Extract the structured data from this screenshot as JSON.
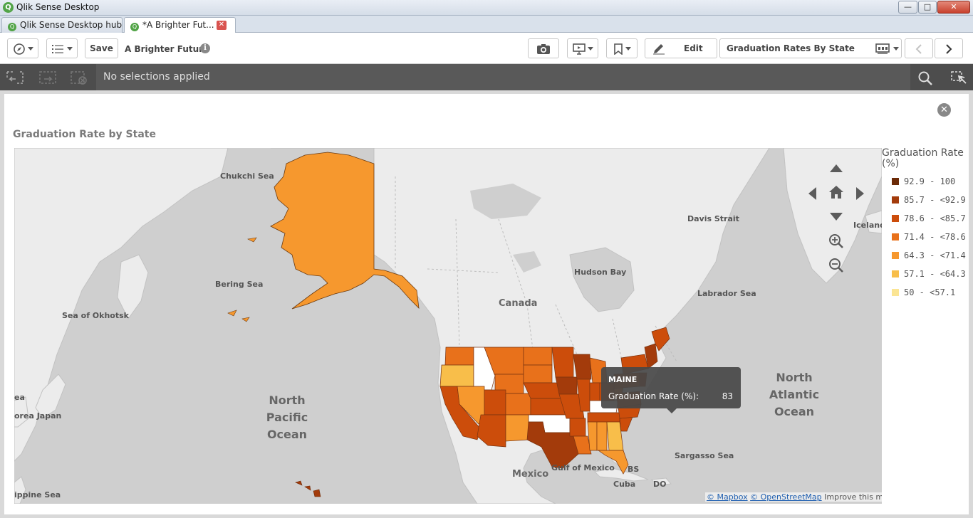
{
  "window": {
    "title": "Qlik Sense Desktop",
    "min_glyph": "—",
    "max_glyph": "□",
    "close_glyph": "✕"
  },
  "tabs": [
    {
      "label": "Qlik Sense Desktop hub"
    },
    {
      "label": "*A Brighter Fut..."
    }
  ],
  "toolbar": {
    "save_label": "Save",
    "app_name": "A Brighter Future",
    "info_glyph": "i",
    "edit_label": "Edit",
    "sheet_name": "Graduation Rates By State"
  },
  "selections": {
    "status_text": "No selections applied"
  },
  "chart": {
    "title": "Graduation Rate by State",
    "close_glyph": "✕"
  },
  "map_labels": {
    "chukchi_sea": "Chukchi Sea",
    "bering_sea": "Bering Sea",
    "sea_of_okhotsk": "Sea of Okhotsk",
    "north_pacific_ocean": "North\nPacific\nOcean",
    "north_atlantic_ocean": "North\nAtlantic\nOcean",
    "canada": "Canada",
    "davis_strait": "Davis Strait",
    "hudson_bay": "Hudson Bay",
    "labrador_sea": "Labrador Sea",
    "iceland": "Iceland",
    "mexico": "Mexico",
    "gulf_of_mexico": "Gulf of Mexico",
    "sargasso_sea": "Sargasso Sea",
    "cuba": "Cuba",
    "bs": "BS",
    "do": "DO",
    "rea_japan": "orea  Japan",
    "ea": "ea",
    "ippine_sea": "ippine Sea"
  },
  "attribution": {
    "mapbox": "© Mapbox",
    "osm": "© OpenStreetMap",
    "improve": "Improve this map"
  },
  "tooltip": {
    "state": "MAINE",
    "measure_label": "Graduation Rate (%):",
    "value": "83"
  },
  "legend": {
    "title": "Graduation Rate (%)",
    "items": [
      {
        "label": "92.9 - 100",
        "color": "#6b2a07"
      },
      {
        "label": "85.7 - <92.9",
        "color": "#a33b0b"
      },
      {
        "label": "78.6 - <85.7",
        "color": "#cc4d0b"
      },
      {
        "label": "71.4 - <78.6",
        "color": "#e8711b"
      },
      {
        "label": "64.3 - <71.4",
        "color": "#f6982e"
      },
      {
        "label": "57.1 - <64.3",
        "color": "#f8be4a"
      },
      {
        "label": "50 - <57.1",
        "color": "#fbe594"
      }
    ]
  }
}
